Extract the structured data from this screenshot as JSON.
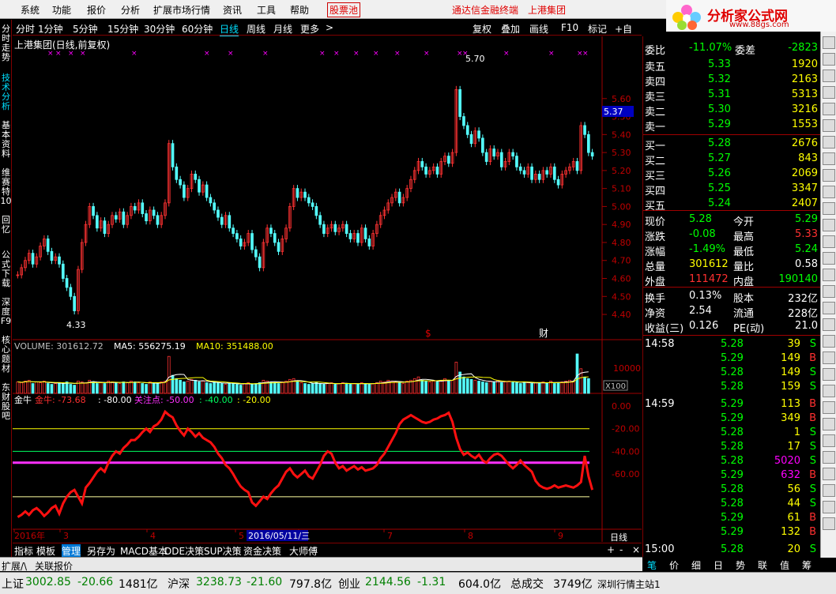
{
  "menu": {
    "items": [
      "系统",
      "功能",
      "报价",
      "分析",
      "扩展市场行情",
      "资讯",
      "工具",
      "帮助"
    ],
    "stock_pool": "股票池",
    "terminal": "通达信金融终端",
    "stock_name": "上港集团",
    "tab_char": "行"
  },
  "logo": {
    "title": "分析家公式网",
    "url": "www.88gs.com"
  },
  "left_tabs": [
    "分时走势",
    "技术分析",
    "基本资料",
    "维赛特10",
    "回忆",
    "公式下载",
    "深度F9",
    "核心题材",
    "东财股吧"
  ],
  "period": {
    "items": [
      "分时",
      "1分钟",
      "5分钟",
      "15分钟",
      "30分钟",
      "60分钟",
      "日线",
      "周线",
      "月线",
      "更多"
    ],
    "selected": "日线",
    "more_arrow": ">",
    "right_buttons": [
      "复权",
      "叠加",
      "画线",
      "F10",
      "标记",
      "+自选"
    ]
  },
  "kline": {
    "title": "上港集团(日线,前复权)",
    "high_label": "5.70",
    "low_label": "4.33",
    "price_marker": "5.37",
    "y_ticks": [
      "5.60",
      "5.50",
      "5.40",
      "5.30",
      "5.20",
      "5.10",
      "5.00",
      "4.90",
      "4.80",
      "4.70",
      "4.60",
      "4.50",
      "4.40"
    ],
    "s_mark": "$",
    "cai_mark": "财"
  },
  "volume": {
    "label": "VOLUME: 301612.72",
    "ma5": "MA5: 556275.19",
    "ma10": "MA10: 351488.00",
    "tick": "10000",
    "unit": "X100"
  },
  "indicator": {
    "name": "金牛",
    "jn": "金牛: -73.68",
    "v2": ": -80.00",
    "gz": "关注点: -50.00",
    "v4": ": -40.00",
    "v5": ": -20.00",
    "y_ticks": [
      "0.00",
      "-20.00",
      "-40.00",
      "-60.00"
    ]
  },
  "xaxis": {
    "labels": [
      "2016年",
      "3",
      "4",
      "5",
      "6",
      "7",
      "8",
      "9"
    ],
    "cursor_date": "2016/05/11/三",
    "right": "日线"
  },
  "chart_data": [
    {
      "type": "line",
      "note": "candlestick price series (daily, approximate)",
      "y_label": "price",
      "ylim": [
        4.33,
        5.7
      ],
      "values": [
        4.62,
        4.66,
        4.7,
        4.74,
        4.68,
        4.72,
        4.78,
        4.82,
        4.75,
        4.7,
        4.72,
        4.68,
        4.6,
        4.55,
        4.5,
        4.42,
        4.65,
        4.8,
        4.9,
        5.0,
        4.95,
        4.88,
        4.92,
        4.85,
        4.9,
        4.95,
        4.93,
        4.97,
        4.9,
        4.95,
        5.0,
        4.98,
        5.02,
        4.96,
        4.92,
        4.98,
        4.95,
        4.9,
        4.95,
        5.02,
        5.35,
        5.22,
        5.15,
        5.12,
        5.05,
        5.1,
        5.18,
        5.15,
        5.08,
        5.12,
        5.05,
        5.02,
        4.98,
        4.94,
        4.9,
        4.95,
        4.88,
        4.85,
        4.82,
        4.78,
        4.8,
        4.85,
        4.76,
        4.72,
        4.66,
        4.8,
        4.88,
        4.85,
        4.8,
        4.75,
        4.82,
        4.88,
        5.0,
        5.1,
        5.05,
        5.08,
        5.05,
        5.02,
        5.0,
        4.95,
        4.9,
        4.85,
        4.88,
        4.9,
        4.86,
        4.88,
        4.9,
        4.85,
        4.82,
        4.85,
        4.8,
        4.88,
        4.82,
        4.78,
        4.85,
        4.9,
        4.95,
        4.98,
        5.02,
        5.05,
        5.08,
        5.02,
        5.05,
        5.1,
        5.15,
        5.2,
        5.25,
        5.22,
        5.18,
        5.2,
        5.22,
        5.18,
        5.25,
        5.28,
        5.24,
        5.3,
        5.65,
        5.5,
        5.45,
        5.4,
        5.35,
        5.42,
        5.38,
        5.3,
        5.25,
        5.32,
        5.28,
        5.3,
        5.22,
        5.25,
        5.3,
        5.28,
        5.22,
        5.2,
        5.18,
        5.22,
        5.15,
        5.18,
        5.15,
        5.2,
        5.18,
        5.22,
        5.15,
        5.12,
        5.18,
        5.2,
        5.22,
        5.25,
        5.2,
        5.45,
        5.4,
        5.3,
        5.28
      ]
    },
    {
      "type": "bar",
      "note": "volume",
      "values": [
        14,
        13,
        15,
        16,
        12,
        14,
        13,
        15,
        12,
        11,
        12,
        13,
        12,
        14,
        11,
        10,
        15,
        14,
        13,
        16,
        14,
        12,
        13,
        12,
        15,
        14,
        13,
        12,
        14,
        13,
        15,
        14,
        13,
        12,
        11,
        14,
        13,
        12,
        14,
        15,
        45,
        22,
        18,
        16,
        14,
        15,
        17,
        16,
        14,
        15,
        13,
        12,
        14,
        13,
        12,
        11,
        13,
        12,
        11,
        10,
        12,
        13,
        11,
        12,
        13,
        16,
        15,
        14,
        13,
        12,
        14,
        15,
        17,
        18,
        14,
        13,
        12,
        11,
        12,
        13,
        12,
        11,
        12,
        13,
        11,
        12,
        13,
        12,
        11,
        12,
        11,
        13,
        12,
        11,
        12,
        13,
        15,
        14,
        16,
        15,
        14,
        13,
        12,
        15,
        16,
        18,
        20,
        16,
        15,
        14,
        15,
        14,
        16,
        18,
        15,
        16,
        38,
        26,
        20,
        18,
        17,
        16,
        15,
        14,
        13,
        15,
        14,
        16,
        13,
        14,
        15,
        14,
        13,
        12,
        14,
        13,
        12,
        13,
        12,
        14,
        13,
        15,
        12,
        13,
        14,
        15,
        16,
        15,
        48,
        30,
        20,
        18
      ]
    },
    {
      "type": "line",
      "note": "金牛 indicator",
      "ylim": [
        -100,
        0
      ],
      "values": [
        -98,
        -96,
        -93,
        -96,
        -92,
        -90,
        -93,
        -97,
        -94,
        -90,
        -88,
        -95,
        -86,
        -80,
        -76,
        -74,
        -80,
        -86,
        -72,
        -68,
        -63,
        -58,
        -55,
        -58,
        -50,
        -44,
        -40,
        -42,
        -37,
        -34,
        -30,
        -30,
        -27,
        -23,
        -20,
        -23,
        -18,
        -16,
        -12,
        -5,
        -8,
        -10,
        -17,
        -22,
        -26,
        -20,
        -23,
        -27,
        -24,
        -28,
        -30,
        -32,
        -36,
        -42,
        -46,
        -52,
        -55,
        -60,
        -66,
        -71,
        -74,
        -76,
        -85,
        -88,
        -84,
        -80,
        -82,
        -77,
        -73,
        -70,
        -64,
        -58,
        -55,
        -60,
        -63,
        -60,
        -57,
        -62,
        -64,
        -58,
        -52,
        -44,
        -40,
        -42,
        -50,
        -55,
        -53,
        -57,
        -55,
        -53,
        -56,
        -54,
        -57,
        -56,
        -55,
        -52,
        -46,
        -42,
        -36,
        -30,
        -24,
        -16,
        -12,
        -10,
        -8,
        -10,
        -12,
        -14,
        -15,
        -14,
        -12,
        -11,
        -9,
        -8,
        -6,
        -14,
        -28,
        -38,
        -43,
        -41,
        -44,
        -46,
        -43,
        -48,
        -50,
        -46,
        -43,
        -42,
        -44,
        -48,
        -52,
        -55,
        -52,
        -48,
        -52,
        -55,
        -58,
        -66,
        -70,
        -72,
        -73,
        -72,
        -70,
        -72,
        -71,
        -70,
        -71,
        -72,
        -70,
        -67,
        -44,
        -62,
        -74
      ]
    }
  ],
  "right_panel": {
    "committee": {
      "k1": "委比",
      "v1": "-11.07%",
      "k2": "委差",
      "v2": "-2823"
    },
    "asks": [
      {
        "l": "卖五",
        "p": "5.33",
        "v": "1920"
      },
      {
        "l": "卖四",
        "p": "5.32",
        "v": "2163"
      },
      {
        "l": "卖三",
        "p": "5.31",
        "v": "5313"
      },
      {
        "l": "卖二",
        "p": "5.30",
        "v": "3216"
      },
      {
        "l": "卖一",
        "p": "5.29",
        "v": "1553"
      }
    ],
    "bids": [
      {
        "l": "买一",
        "p": "5.28",
        "v": "2676"
      },
      {
        "l": "买二",
        "p": "5.27",
        "v": "843"
      },
      {
        "l": "买三",
        "p": "5.26",
        "v": "2069"
      },
      {
        "l": "买四",
        "p": "5.25",
        "v": "3347"
      },
      {
        "l": "买五",
        "p": "5.24",
        "v": "2407"
      }
    ],
    "quotes": [
      {
        "l": "现价",
        "v": "5.28",
        "l2": "今开",
        "v2": "5.29"
      },
      {
        "l": "涨跌",
        "v": "-0.08",
        "l2": "最高",
        "v2": "5.33"
      },
      {
        "l": "涨幅",
        "v": "-1.49%",
        "l2": "最低",
        "v2": "5.24"
      },
      {
        "l": "总量",
        "v": "301612",
        "l2": "量比",
        "v2": "0.58"
      },
      {
        "l": "外盘",
        "v": "111472",
        "l2": "内盘",
        "v2": "190140"
      }
    ],
    "stats": [
      {
        "l": "换手",
        "v": "0.13%",
        "l2": "股本",
        "v2": "232亿"
      },
      {
        "l": "净资",
        "v": "2.54",
        "l2": "流通",
        "v2": "228亿"
      },
      {
        "l": "收益(三)",
        "v": "0.126",
        "l2": "PE(动)",
        "v2": "21.0"
      }
    ],
    "ticks": [
      {
        "t": "14:58",
        "p": "5.28",
        "v": "39",
        "d": "S"
      },
      {
        "t": "",
        "p": "5.29",
        "v": "149",
        "d": "B"
      },
      {
        "t": "",
        "p": "5.28",
        "v": "149",
        "d": "S"
      },
      {
        "t": "",
        "p": "5.28",
        "v": "159",
        "d": "S"
      },
      {
        "t": "14:59",
        "p": "5.29",
        "v": "113",
        "d": "B"
      },
      {
        "t": "",
        "p": "5.29",
        "v": "349",
        "d": "B"
      },
      {
        "t": "",
        "p": "5.28",
        "v": "1",
        "d": "S"
      },
      {
        "t": "",
        "p": "5.28",
        "v": "17",
        "d": "S"
      },
      {
        "t": "",
        "p": "5.28",
        "v": "5020",
        "d": "S"
      },
      {
        "t": "",
        "p": "5.29",
        "v": "632",
        "d": "B"
      },
      {
        "t": "",
        "p": "5.28",
        "v": "56",
        "d": "S"
      },
      {
        "t": "",
        "p": "5.28",
        "v": "44",
        "d": "S"
      },
      {
        "t": "",
        "p": "5.29",
        "v": "61",
        "d": "B"
      },
      {
        "t": "",
        "p": "5.29",
        "v": "132",
        "d": "B"
      },
      {
        "t": "15:00",
        "p": "5.28",
        "v": "20",
        "d": "S"
      }
    ],
    "bottom_tabs": [
      "笔",
      "价",
      "细",
      "日",
      "势",
      "联",
      "值",
      "筹"
    ]
  },
  "bottom_tabs": [
    "指标",
    "模板",
    "管理",
    "另存为",
    "MACD基本",
    "DDE决策",
    "SUP决策",
    "资金决策",
    "大师傅"
  ],
  "bottom_right": [
    "+",
    "-",
    "×"
  ],
  "expand": {
    "a": "扩展/\\",
    "b": "关联报价"
  },
  "status": {
    "sh_label": "上证",
    "sh_val": "3002.85",
    "sh_chg": "-20.66",
    "sh_amt": "1481亿",
    "hs_label": "沪深",
    "hs_val": "3238.73",
    "hs_chg": "-21.60",
    "hs_amt": "797.8亿",
    "cy_label": "创业",
    "cy_val": "2144.56",
    "cy_chg": "-1.31",
    "cy_amt": "604.0亿",
    "total_label": "总成交",
    "total_val": "3749亿",
    "server": "深圳行情主站1"
  }
}
